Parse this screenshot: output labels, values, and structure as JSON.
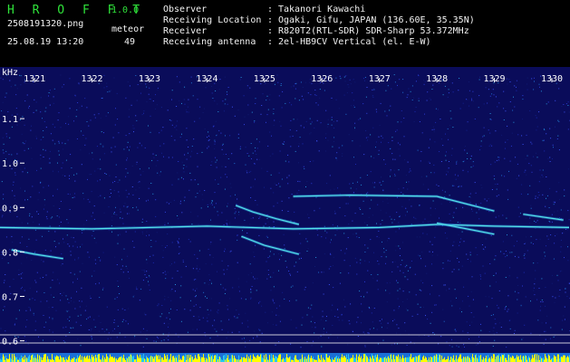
{
  "app": {
    "name": "H R O F F T",
    "version": "1.0.0"
  },
  "capture": {
    "filename": "2508191320.png",
    "datetime": "25.08.19 13:20",
    "type_label": "meteor",
    "count": "49"
  },
  "info": {
    "rows": [
      {
        "label": "Observer",
        "sep": ":",
        "value": "Takanori Kawachi"
      },
      {
        "label": "Receiving Location",
        "sep": ":",
        "value": "Ogaki, Gifu, JAPAN (136.60E, 35.35N)"
      },
      {
        "label": "Receiver",
        "sep": ":",
        "value": "R820T2(RTL-SDR) SDR-Sharp 53.372MHz"
      },
      {
        "label": "Receiving antenna",
        "sep": ":",
        "value": "2el-HB9CV Vertical (el. E-W)"
      }
    ]
  },
  "chart_data": {
    "type": "heatmap",
    "y_unit_label": "kHz",
    "x_ticks": [
      "1321",
      "1322",
      "1323",
      "1324",
      "1325",
      "1326",
      "1327",
      "1328",
      "1329",
      "1330"
    ],
    "y_ticks": [
      "1.1",
      "1.0",
      "0.9",
      "0.8",
      "0.7",
      "0.6"
    ],
    "x_range": [
      1320.4,
      1330.3
    ],
    "y_range": [
      0.585,
      1.2
    ],
    "traces": [
      {
        "points": [
          [
            1320.4,
            0.855
          ],
          [
            1322.0,
            0.852
          ],
          [
            1324.0,
            0.858
          ],
          [
            1325.5,
            0.852
          ],
          [
            1327.0,
            0.855
          ],
          [
            1328.0,
            0.862
          ],
          [
            1329.0,
            0.858
          ],
          [
            1330.3,
            0.855
          ]
        ]
      },
      {
        "points": [
          [
            1320.6,
            0.805
          ],
          [
            1321.0,
            0.795
          ],
          [
            1321.5,
            0.785
          ]
        ]
      },
      {
        "points": [
          [
            1324.5,
            0.905
          ],
          [
            1324.8,
            0.89
          ],
          [
            1325.2,
            0.875
          ],
          [
            1325.6,
            0.862
          ]
        ]
      },
      {
        "points": [
          [
            1324.6,
            0.835
          ],
          [
            1325.0,
            0.815
          ],
          [
            1325.6,
            0.795
          ]
        ]
      },
      {
        "points": [
          [
            1325.5,
            0.925
          ],
          [
            1326.5,
            0.928
          ],
          [
            1328.0,
            0.925
          ],
          [
            1329.0,
            0.892
          ]
        ]
      },
      {
        "points": [
          [
            1329.5,
            0.885
          ],
          [
            1330.2,
            0.872
          ]
        ]
      },
      {
        "points": [
          [
            1328.0,
            0.865
          ],
          [
            1329.0,
            0.84
          ]
        ]
      }
    ],
    "colors": {
      "background": "#0a0c5a",
      "trace": "#55e3e7",
      "text": "#ffffff",
      "baseline": "#ffff00",
      "floor": "#1c6fd6"
    }
  }
}
